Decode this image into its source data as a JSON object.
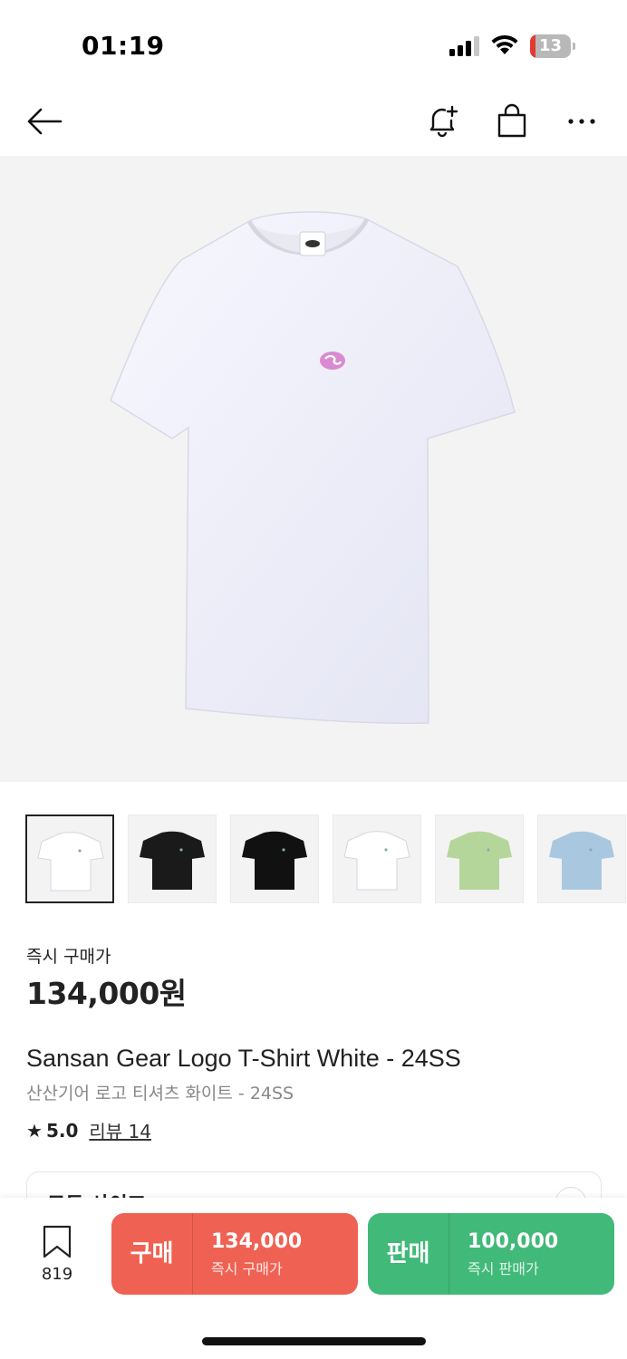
{
  "status_bar": {
    "time": "01:19",
    "battery_level": 13,
    "battery_text": "13",
    "battery_color": "#e23a31"
  },
  "nav": {
    "icons": [
      "back-arrow-icon",
      "bell-plus-icon",
      "shopping-bag-icon",
      "more-icon"
    ]
  },
  "product": {
    "thumbnail_colors": [
      "#ffffff",
      "#1a1a1a",
      "#111111",
      "#ffffff",
      "#b5d69a",
      "#a9c8e0"
    ],
    "price_label": "즉시 구매가",
    "price": "134,000원",
    "title_en": "Sansan Gear Logo T-Shirt White - 24SS",
    "title_ko": "산산기어 로고 티셔츠 화이트 - 24SS",
    "rating": "5.0",
    "review_link": "리뷰 14",
    "size_label": "모든 사이즈"
  },
  "bottom_bar": {
    "wish_count": "819",
    "buy": {
      "label": "구매",
      "amount": "134,000",
      "sub": "즉시 구매가",
      "color": "#ef6253"
    },
    "sell": {
      "label": "판매",
      "amount": "100,000",
      "sub": "즉시 판매가",
      "color": "#41b979"
    }
  }
}
